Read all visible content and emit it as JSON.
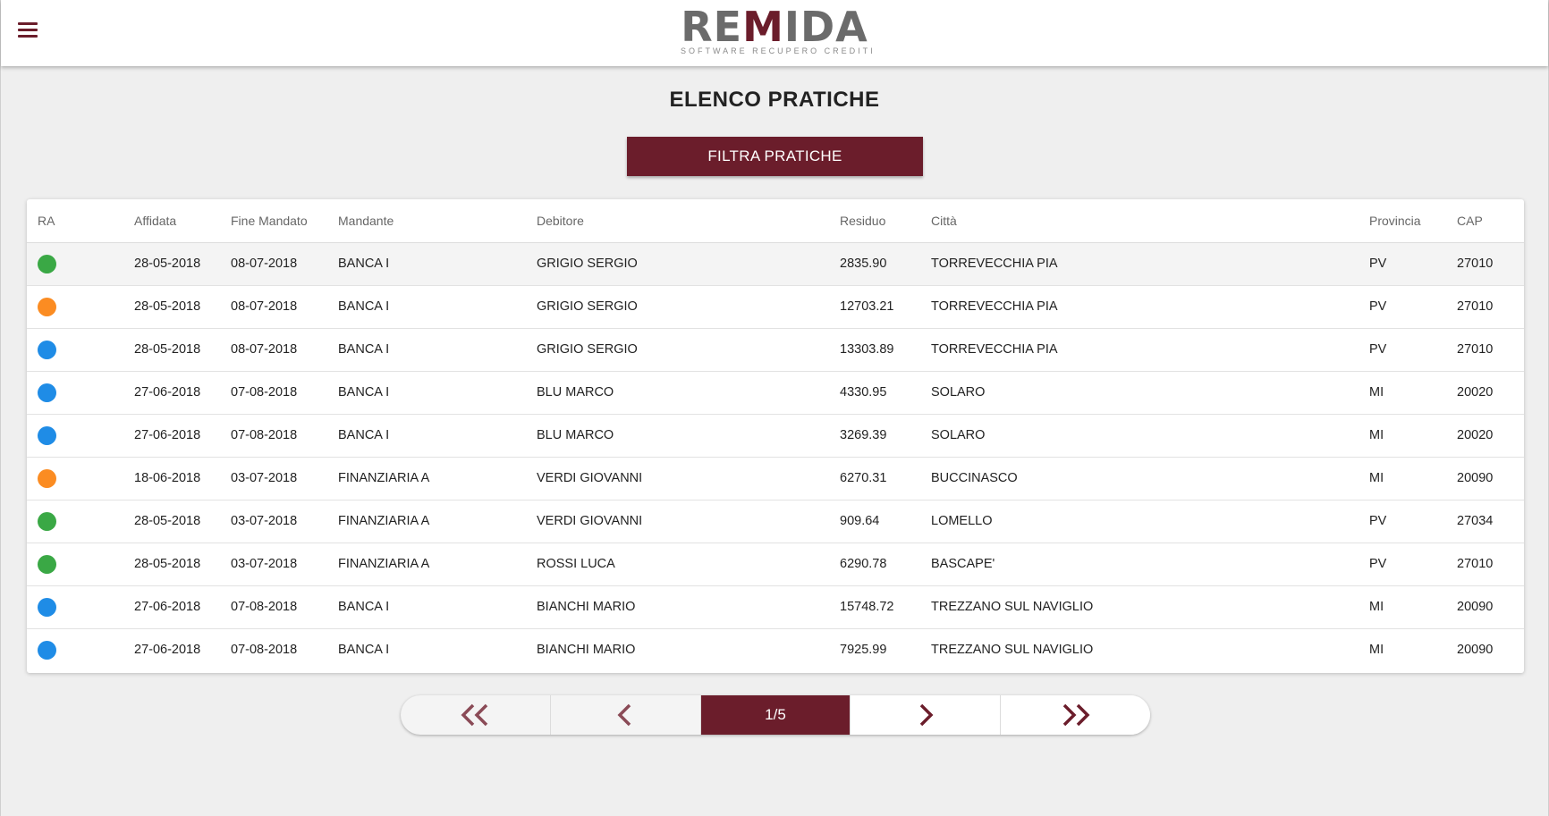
{
  "header": {
    "logo": {
      "left": "RE",
      "m": "M",
      "right": "IDA",
      "tagline": "SOFTWARE RECUPERO CREDITI"
    }
  },
  "page": {
    "title": "ELENCO PRATICHE",
    "filter_label": "FILTRA PRATICHE"
  },
  "colors": {
    "accent": "#6b1d2b",
    "status_green": "#3aa845",
    "status_orange": "#fb8c22",
    "status_blue": "#1f8ce6"
  },
  "table": {
    "columns": [
      "RA",
      "Affidata",
      "Fine Mandato",
      "Mandante",
      "Debitore",
      "Residuo",
      "Città",
      "Provincia",
      "CAP"
    ],
    "rows": [
      {
        "ra": "green",
        "affidata": "28-05-2018",
        "fine": "08-07-2018",
        "mandante": "BANCA I",
        "debitore": "GRIGIO SERGIO",
        "residuo": "2835.90",
        "citta": "TORREVECCHIA PIA",
        "provincia": "PV",
        "cap": "27010"
      },
      {
        "ra": "orange",
        "affidata": "28-05-2018",
        "fine": "08-07-2018",
        "mandante": "BANCA I",
        "debitore": "GRIGIO SERGIO",
        "residuo": "12703.21",
        "citta": "TORREVECCHIA PIA",
        "provincia": "PV",
        "cap": "27010"
      },
      {
        "ra": "blue",
        "affidata": "28-05-2018",
        "fine": "08-07-2018",
        "mandante": "BANCA I",
        "debitore": "GRIGIO SERGIO",
        "residuo": "13303.89",
        "citta": "TORREVECCHIA PIA",
        "provincia": "PV",
        "cap": "27010"
      },
      {
        "ra": "blue",
        "affidata": "27-06-2018",
        "fine": "07-08-2018",
        "mandante": "BANCA I",
        "debitore": "BLU MARCO",
        "residuo": "4330.95",
        "citta": "SOLARO",
        "provincia": "MI",
        "cap": "20020"
      },
      {
        "ra": "blue",
        "affidata": "27-06-2018",
        "fine": "07-08-2018",
        "mandante": "BANCA I",
        "debitore": "BLU MARCO",
        "residuo": "3269.39",
        "citta": "SOLARO",
        "provincia": "MI",
        "cap": "20020"
      },
      {
        "ra": "orange",
        "affidata": "18-06-2018",
        "fine": "03-07-2018",
        "mandante": "FINANZIARIA A",
        "debitore": "VERDI GIOVANNI",
        "residuo": "6270.31",
        "citta": "BUCCINASCO",
        "provincia": "MI",
        "cap": "20090"
      },
      {
        "ra": "green",
        "affidata": "28-05-2018",
        "fine": "03-07-2018",
        "mandante": "FINANZIARIA A",
        "debitore": "VERDI GIOVANNI",
        "residuo": "909.64",
        "citta": "LOMELLO",
        "provincia": "PV",
        "cap": "27034"
      },
      {
        "ra": "green",
        "affidata": "28-05-2018",
        "fine": "03-07-2018",
        "mandante": "FINANZIARIA A",
        "debitore": "ROSSI LUCA",
        "residuo": "6290.78",
        "citta": "BASCAPE'",
        "provincia": "PV",
        "cap": "27010"
      },
      {
        "ra": "blue",
        "affidata": "27-06-2018",
        "fine": "07-08-2018",
        "mandante": "BANCA I",
        "debitore": "BIANCHI MARIO",
        "residuo": "15748.72",
        "citta": "TREZZANO SUL NAVIGLIO",
        "provincia": "MI",
        "cap": "20090"
      },
      {
        "ra": "blue",
        "affidata": "27-06-2018",
        "fine": "07-08-2018",
        "mandante": "BANCA I",
        "debitore": "BIANCHI MARIO",
        "residuo": "7925.99",
        "citta": "TREZZANO SUL NAVIGLIO",
        "provincia": "MI",
        "cap": "20090"
      }
    ]
  },
  "pagination": {
    "current": "1/5",
    "icons": [
      "first-page-icon",
      "previous-page-icon",
      "next-page-icon",
      "last-page-icon"
    ]
  }
}
